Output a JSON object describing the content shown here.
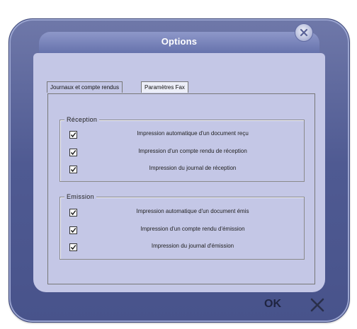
{
  "window": {
    "title": "Options"
  },
  "tabs": [
    {
      "label": "Journaux et compte rendus",
      "active": true
    },
    {
      "label": "Paramètres Fax",
      "active": false
    }
  ],
  "groups": {
    "reception": {
      "label": "Réception",
      "items": [
        {
          "label": "Impression automatique d'un document reçu",
          "checked": true
        },
        {
          "label": "Impression  d'un compte rendu de réception",
          "checked": true
        },
        {
          "label": "Impression du journal de réception",
          "checked": true
        }
      ]
    },
    "emission": {
      "label": "Emission",
      "items": [
        {
          "label": "Impression automatique d'un document émis",
          "checked": true
        },
        {
          "label": "Impression  d'un compte rendu d'émission",
          "checked": true
        },
        {
          "label": "Impression du journal d'émission",
          "checked": true
        }
      ]
    }
  },
  "buttons": {
    "ok_label": "OK",
    "cancel_icon": "x-icon",
    "close_icon": "close-icon"
  },
  "colors": {
    "frame": "#4f5a92",
    "panel": "#c4c7e6",
    "title_text": "#ffffff"
  }
}
